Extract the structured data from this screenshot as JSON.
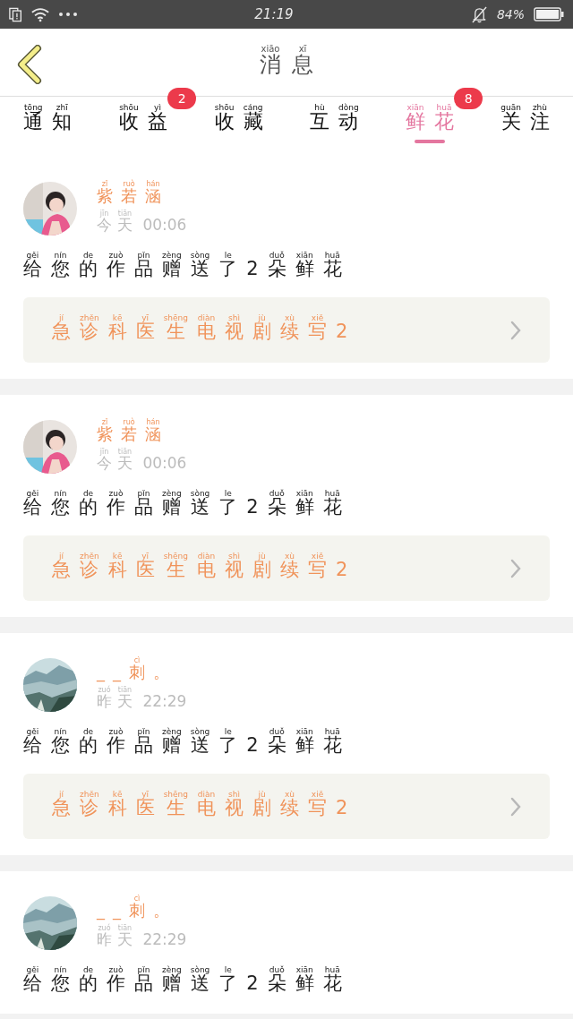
{
  "status_bar": {
    "time": "21:19",
    "battery": "84%"
  },
  "header": {
    "title": [
      [
        "xiāo",
        "消"
      ],
      [
        "xī",
        "息"
      ]
    ]
  },
  "tabs": [
    {
      "label": [
        [
          "tōng",
          "通"
        ],
        [
          "zhī",
          "知"
        ]
      ],
      "selected": false
    },
    {
      "label": [
        [
          "shōu",
          "收"
        ],
        [
          "yì",
          "益"
        ]
      ],
      "selected": false,
      "badge": "2"
    },
    {
      "label": [
        [
          "shōu",
          "收"
        ],
        [
          "cáng",
          "藏"
        ]
      ],
      "selected": false
    },
    {
      "label": [
        [
          "hù",
          "互"
        ],
        [
          "dòng",
          "动"
        ]
      ],
      "selected": false
    },
    {
      "label": [
        [
          "xiān",
          "鲜"
        ],
        [
          "huā",
          "花"
        ]
      ],
      "selected": true,
      "badge": "8"
    },
    {
      "label": [
        [
          "guān",
          "关"
        ],
        [
          "zhù",
          "注"
        ]
      ],
      "selected": false
    }
  ],
  "messages": [
    {
      "avatar": {
        "kind": "figure"
      },
      "name": [
        [
          "zǐ",
          "紫"
        ],
        [
          "ruò",
          "若"
        ],
        [
          "hán",
          "涵"
        ]
      ],
      "time": [
        [
          "jīn",
          "今"
        ],
        [
          "tiān",
          "天"
        ],
        [
          " 00:06"
        ]
      ],
      "text": [
        [
          "gěi",
          "给"
        ],
        [
          "nín",
          "您"
        ],
        [
          "de",
          "的"
        ],
        [
          "zuò",
          "作"
        ],
        [
          "pǐn",
          "品"
        ],
        [
          "zèng",
          "赠"
        ],
        [
          "sòng",
          "送"
        ],
        [
          "le",
          "了"
        ],
        [
          "2"
        ],
        [
          "duǒ",
          "朵"
        ],
        [
          "xiān",
          "鲜"
        ],
        [
          "huā",
          "花"
        ]
      ],
      "link": [
        [
          "jí",
          "急"
        ],
        [
          "zhěn",
          "诊"
        ],
        [
          "kē",
          "科"
        ],
        [
          "yī",
          "医"
        ],
        [
          "shēng",
          "生"
        ],
        [
          "diàn",
          "电"
        ],
        [
          "shì",
          "视"
        ],
        [
          "jù",
          "剧"
        ],
        [
          "xù",
          "续"
        ],
        [
          "xiě",
          "写"
        ],
        [
          "2"
        ]
      ]
    },
    {
      "avatar": {
        "kind": "figure"
      },
      "name": [
        [
          "zǐ",
          "紫"
        ],
        [
          "ruò",
          "若"
        ],
        [
          "hán",
          "涵"
        ]
      ],
      "time": [
        [
          "jīn",
          "今"
        ],
        [
          "tiān",
          "天"
        ],
        [
          " 00:06"
        ]
      ],
      "text": [
        [
          "gěi",
          "给"
        ],
        [
          "nín",
          "您"
        ],
        [
          "de",
          "的"
        ],
        [
          "zuò",
          "作"
        ],
        [
          "pǐn",
          "品"
        ],
        [
          "zèng",
          "赠"
        ],
        [
          "sòng",
          "送"
        ],
        [
          "le",
          "了"
        ],
        [
          "2"
        ],
        [
          "duǒ",
          "朵"
        ],
        [
          "xiān",
          "鲜"
        ],
        [
          "huā",
          "花"
        ]
      ],
      "link": [
        [
          "jí",
          "急"
        ],
        [
          "zhěn",
          "诊"
        ],
        [
          "kē",
          "科"
        ],
        [
          "yī",
          "医"
        ],
        [
          "shēng",
          "生"
        ],
        [
          "diàn",
          "电"
        ],
        [
          "shì",
          "视"
        ],
        [
          "jù",
          "剧"
        ],
        [
          "xù",
          "续"
        ],
        [
          "xiě",
          "写"
        ],
        [
          "2"
        ]
      ]
    },
    {
      "avatar": {
        "kind": "landscape"
      },
      "name": [
        [
          "_"
        ],
        [
          "_"
        ],
        [
          "cì",
          "刺"
        ],
        [
          "。"
        ]
      ],
      "time": [
        [
          "zuó",
          "昨"
        ],
        [
          "tiān",
          "天"
        ],
        [
          " 22:29"
        ]
      ],
      "text": [
        [
          "gěi",
          "给"
        ],
        [
          "nín",
          "您"
        ],
        [
          "de",
          "的"
        ],
        [
          "zuò",
          "作"
        ],
        [
          "pǐn",
          "品"
        ],
        [
          "zèng",
          "赠"
        ],
        [
          "sòng",
          "送"
        ],
        [
          "le",
          "了"
        ],
        [
          "2"
        ],
        [
          "duǒ",
          "朵"
        ],
        [
          "xiān",
          "鲜"
        ],
        [
          "huā",
          "花"
        ]
      ],
      "link": [
        [
          "jí",
          "急"
        ],
        [
          "zhěn",
          "诊"
        ],
        [
          "kē",
          "科"
        ],
        [
          "yī",
          "医"
        ],
        [
          "shēng",
          "生"
        ],
        [
          "diàn",
          "电"
        ],
        [
          "shì",
          "视"
        ],
        [
          "jù",
          "剧"
        ],
        [
          "xù",
          "续"
        ],
        [
          "xiě",
          "写"
        ],
        [
          "2"
        ]
      ]
    },
    {
      "avatar": {
        "kind": "landscape"
      },
      "name": [
        [
          "_"
        ],
        [
          "_"
        ],
        [
          "cì",
          "刺"
        ],
        [
          "。"
        ]
      ],
      "time": [
        [
          "zuó",
          "昨"
        ],
        [
          "tiān",
          "天"
        ],
        [
          " 22:29"
        ]
      ],
      "text": [
        [
          "gěi",
          "给"
        ],
        [
          "nín",
          "您"
        ],
        [
          "de",
          "的"
        ],
        [
          "zuò",
          "作"
        ],
        [
          "pǐn",
          "品"
        ],
        [
          "zèng",
          "赠"
        ],
        [
          "sòng",
          "送"
        ],
        [
          "le",
          "了"
        ],
        [
          "2"
        ],
        [
          "duǒ",
          "朵"
        ],
        [
          "xiān",
          "鲜"
        ],
        [
          "huā",
          "花"
        ]
      ]
    }
  ]
}
